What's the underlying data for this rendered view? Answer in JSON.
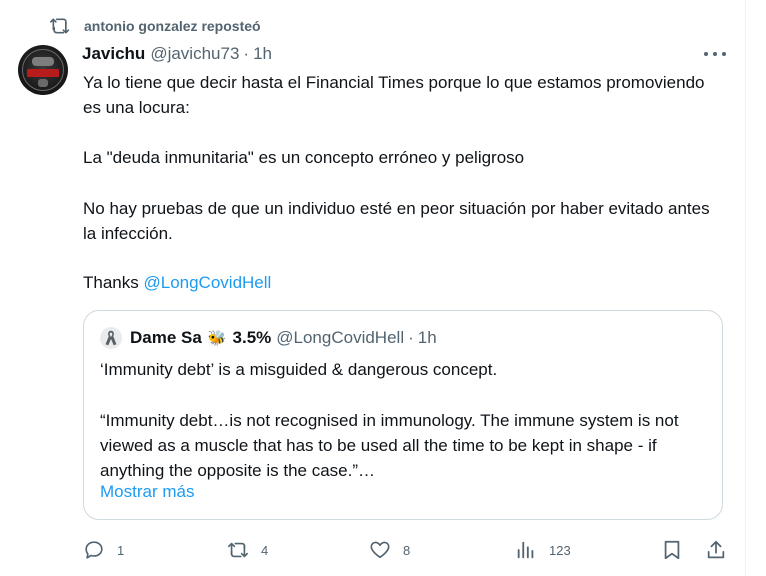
{
  "repost": {
    "text": "antonio gonzalez reposteó"
  },
  "post": {
    "author_name": "Javichu",
    "author_handle": "@javichu73",
    "separator": "·",
    "time": "1h",
    "paragraphs": [
      "Ya lo tiene que decir hasta el Financial Times porque lo que estamos promoviendo es una locura:",
      "La \"deuda inmunitaria\" es un concepto erróneo y peligroso",
      "No hay pruebas de que un individuo esté en peor situación por haber evitado antes la infección."
    ],
    "thanks_prefix": "Thanks ",
    "mention": "@LongCovidHell"
  },
  "quote": {
    "author_name": "Dame Sa",
    "emoji": "🐝",
    "percent": "3.5%",
    "author_handle": "@LongCovidHell",
    "separator": "·",
    "time": "1h",
    "paragraphs": [
      "‘Immunity debt’ is a misguided & dangerous concept.",
      "“Immunity debt…is not recognised in immunology. The immune system is not viewed as a muscle that has to be used all the time to be kept in shape - if anything the opposite is the case.”…"
    ],
    "show_more": "Mostrar más"
  },
  "actions": {
    "replies": "1",
    "reposts": "4",
    "likes": "8",
    "views": "123"
  },
  "icons": {
    "repost": "repost-icon",
    "more": "more-icon",
    "ribbon": "ribbon-icon",
    "reply": "reply-icon",
    "like": "heart-icon",
    "views": "views-icon",
    "bookmark": "bookmark-icon",
    "share": "share-icon"
  },
  "colors": {
    "accent": "#1d9bf0",
    "muted": "#536471",
    "text": "#0f1419",
    "border": "#cfd9de"
  }
}
